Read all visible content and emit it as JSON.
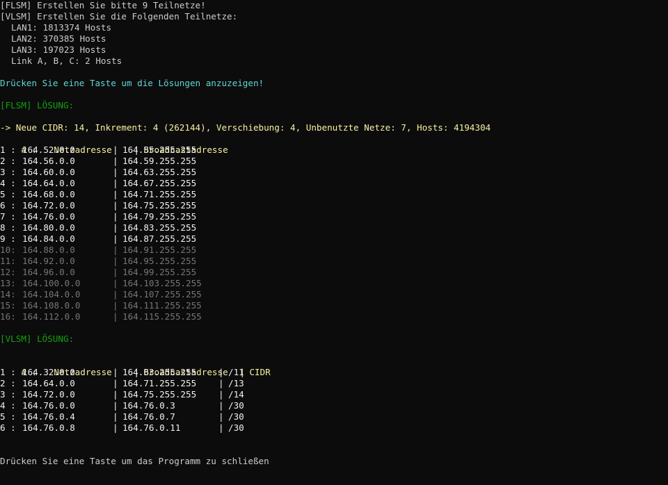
{
  "console": {
    "header": [
      "[FLSM] Erstellen Sie bitte 9 Teilnetze!",
      "[VLSM] Erstellen Sie die Folgenden Teilnetze:"
    ],
    "lans": [
      "LAN1: 1813374 Hosts",
      "LAN2: 370385 Hosts",
      "LAN3: 197023 Hosts",
      "Link A, B, C: 2 Hosts"
    ],
    "prompt_show": "Drücken Sie eine Taste um die Lösungen anzuzeigen!",
    "flsm_title": "[FLSM] LÖSUNG:",
    "flsm_info": "-> Neue CIDR: 14, Inkrement: 4 (262144), Verschiebung: 4, Unbenutzte Netze: 7, Hosts: 4194304",
    "flsm_header": {
      "num": "# :",
      "net": "Netzadresse",
      "broadcast": "Broadcastadresse"
    },
    "flsm_rows": [
      {
        "prefix": "1 : ",
        "net": "164.52.0.0",
        "broadcast": "164.55.255.255",
        "used": true
      },
      {
        "prefix": "2 : ",
        "net": "164.56.0.0",
        "broadcast": "164.59.255.255",
        "used": true
      },
      {
        "prefix": "3 : ",
        "net": "164.60.0.0",
        "broadcast": "164.63.255.255",
        "used": true
      },
      {
        "prefix": "4 : ",
        "net": "164.64.0.0",
        "broadcast": "164.67.255.255",
        "used": true
      },
      {
        "prefix": "5 : ",
        "net": "164.68.0.0",
        "broadcast": "164.71.255.255",
        "used": true
      },
      {
        "prefix": "6 : ",
        "net": "164.72.0.0",
        "broadcast": "164.75.255.255",
        "used": true
      },
      {
        "prefix": "7 : ",
        "net": "164.76.0.0",
        "broadcast": "164.79.255.255",
        "used": true
      },
      {
        "prefix": "8 : ",
        "net": "164.80.0.0",
        "broadcast": "164.83.255.255",
        "used": true
      },
      {
        "prefix": "9 : ",
        "net": "164.84.0.0",
        "broadcast": "164.87.255.255",
        "used": true
      },
      {
        "prefix": "10: ",
        "net": "164.88.0.0",
        "broadcast": "164.91.255.255",
        "used": false
      },
      {
        "prefix": "11: ",
        "net": "164.92.0.0",
        "broadcast": "164.95.255.255",
        "used": false
      },
      {
        "prefix": "12: ",
        "net": "164.96.0.0",
        "broadcast": "164.99.255.255",
        "used": false
      },
      {
        "prefix": "13: ",
        "net": "164.100.0.0",
        "broadcast": "164.103.255.255",
        "used": false
      },
      {
        "prefix": "14: ",
        "net": "164.104.0.0",
        "broadcast": "164.107.255.255",
        "used": false
      },
      {
        "prefix": "15: ",
        "net": "164.108.0.0",
        "broadcast": "164.111.255.255",
        "used": false
      },
      {
        "prefix": "16: ",
        "net": "164.112.0.0",
        "broadcast": "164.115.255.255",
        "used": false
      }
    ],
    "vlsm_title": "[VLSM] LÖSUNG:",
    "vlsm_header": {
      "num": "# :",
      "net": "Netzadresse",
      "broadcast": "Broadcastadresse",
      "cidr": "CIDR"
    },
    "vlsm_rows": [
      {
        "prefix": "1 : ",
        "net": "164.32.0.0",
        "broadcast": "164.63.255.255",
        "cidr": "/11"
      },
      {
        "prefix": "2 : ",
        "net": "164.64.0.0",
        "broadcast": "164.71.255.255",
        "cidr": "/13"
      },
      {
        "prefix": "3 : ",
        "net": "164.72.0.0",
        "broadcast": "164.75.255.255",
        "cidr": "/14"
      },
      {
        "prefix": "4 : ",
        "net": "164.76.0.0",
        "broadcast": "164.76.0.3",
        "cidr": "/30"
      },
      {
        "prefix": "5 : ",
        "net": "164.76.0.4",
        "broadcast": "164.76.0.7",
        "cidr": "/30"
      },
      {
        "prefix": "6 : ",
        "net": "164.76.0.8",
        "broadcast": "164.76.0.11",
        "cidr": "/30"
      }
    ],
    "prompt_exit": "Drücken Sie eine Taste um das Programm zu schließen",
    "colors": {
      "background": "#0c0c0c",
      "text": "#cccccc",
      "cyan": "#61d6d6",
      "green": "#13a10e",
      "yellow": "#f9f1a5",
      "white": "#f2f2f2",
      "gray": "#767676"
    }
  }
}
